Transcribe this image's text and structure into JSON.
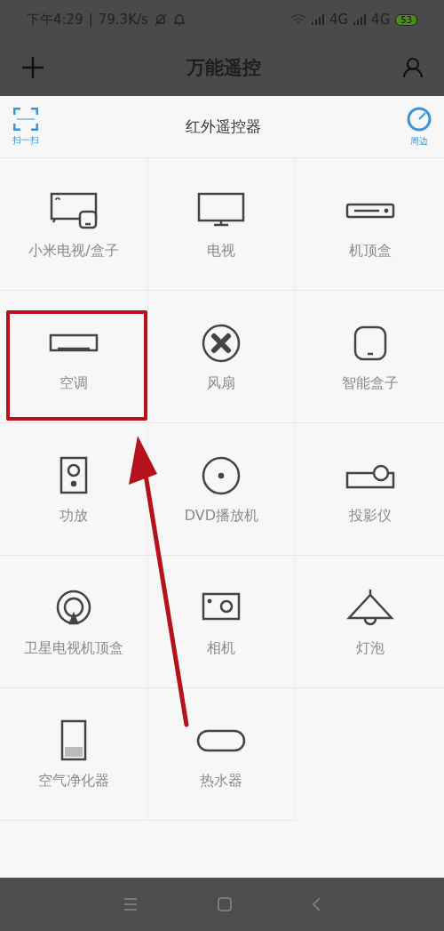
{
  "status_bar": {
    "time": "下午4:29",
    "separator": "|",
    "speed": "79.3K/s",
    "network_1": "4G",
    "network_2": "4G",
    "battery": "53"
  },
  "app_bar": {
    "title": "万能遥控"
  },
  "sheet": {
    "title": "红外遥控器",
    "scan_label": "扫一扫",
    "nearby_label": "周边"
  },
  "devices": [
    {
      "label": "小米电视/盒子",
      "kind": "mitv",
      "highlighted": false
    },
    {
      "label": "电视",
      "kind": "tv",
      "highlighted": false
    },
    {
      "label": "机顶盒",
      "kind": "stb",
      "highlighted": false
    },
    {
      "label": "空调",
      "kind": "ac",
      "highlighted": true
    },
    {
      "label": "风扇",
      "kind": "fan",
      "highlighted": false
    },
    {
      "label": "智能盒子",
      "kind": "box",
      "highlighted": false
    },
    {
      "label": "功放",
      "kind": "speaker",
      "highlighted": false
    },
    {
      "label": "DVD播放机",
      "kind": "dvd",
      "highlighted": false
    },
    {
      "label": "投影仪",
      "kind": "projector",
      "highlighted": false
    },
    {
      "label": "卫星电视机顶盒",
      "kind": "satellite",
      "highlighted": false
    },
    {
      "label": "相机",
      "kind": "camera",
      "highlighted": false
    },
    {
      "label": "灯泡",
      "kind": "lamp",
      "highlighted": false
    },
    {
      "label": "空气净化器",
      "kind": "purifier",
      "highlighted": false
    },
    {
      "label": "热水器",
      "kind": "heater",
      "highlighted": false
    }
  ]
}
